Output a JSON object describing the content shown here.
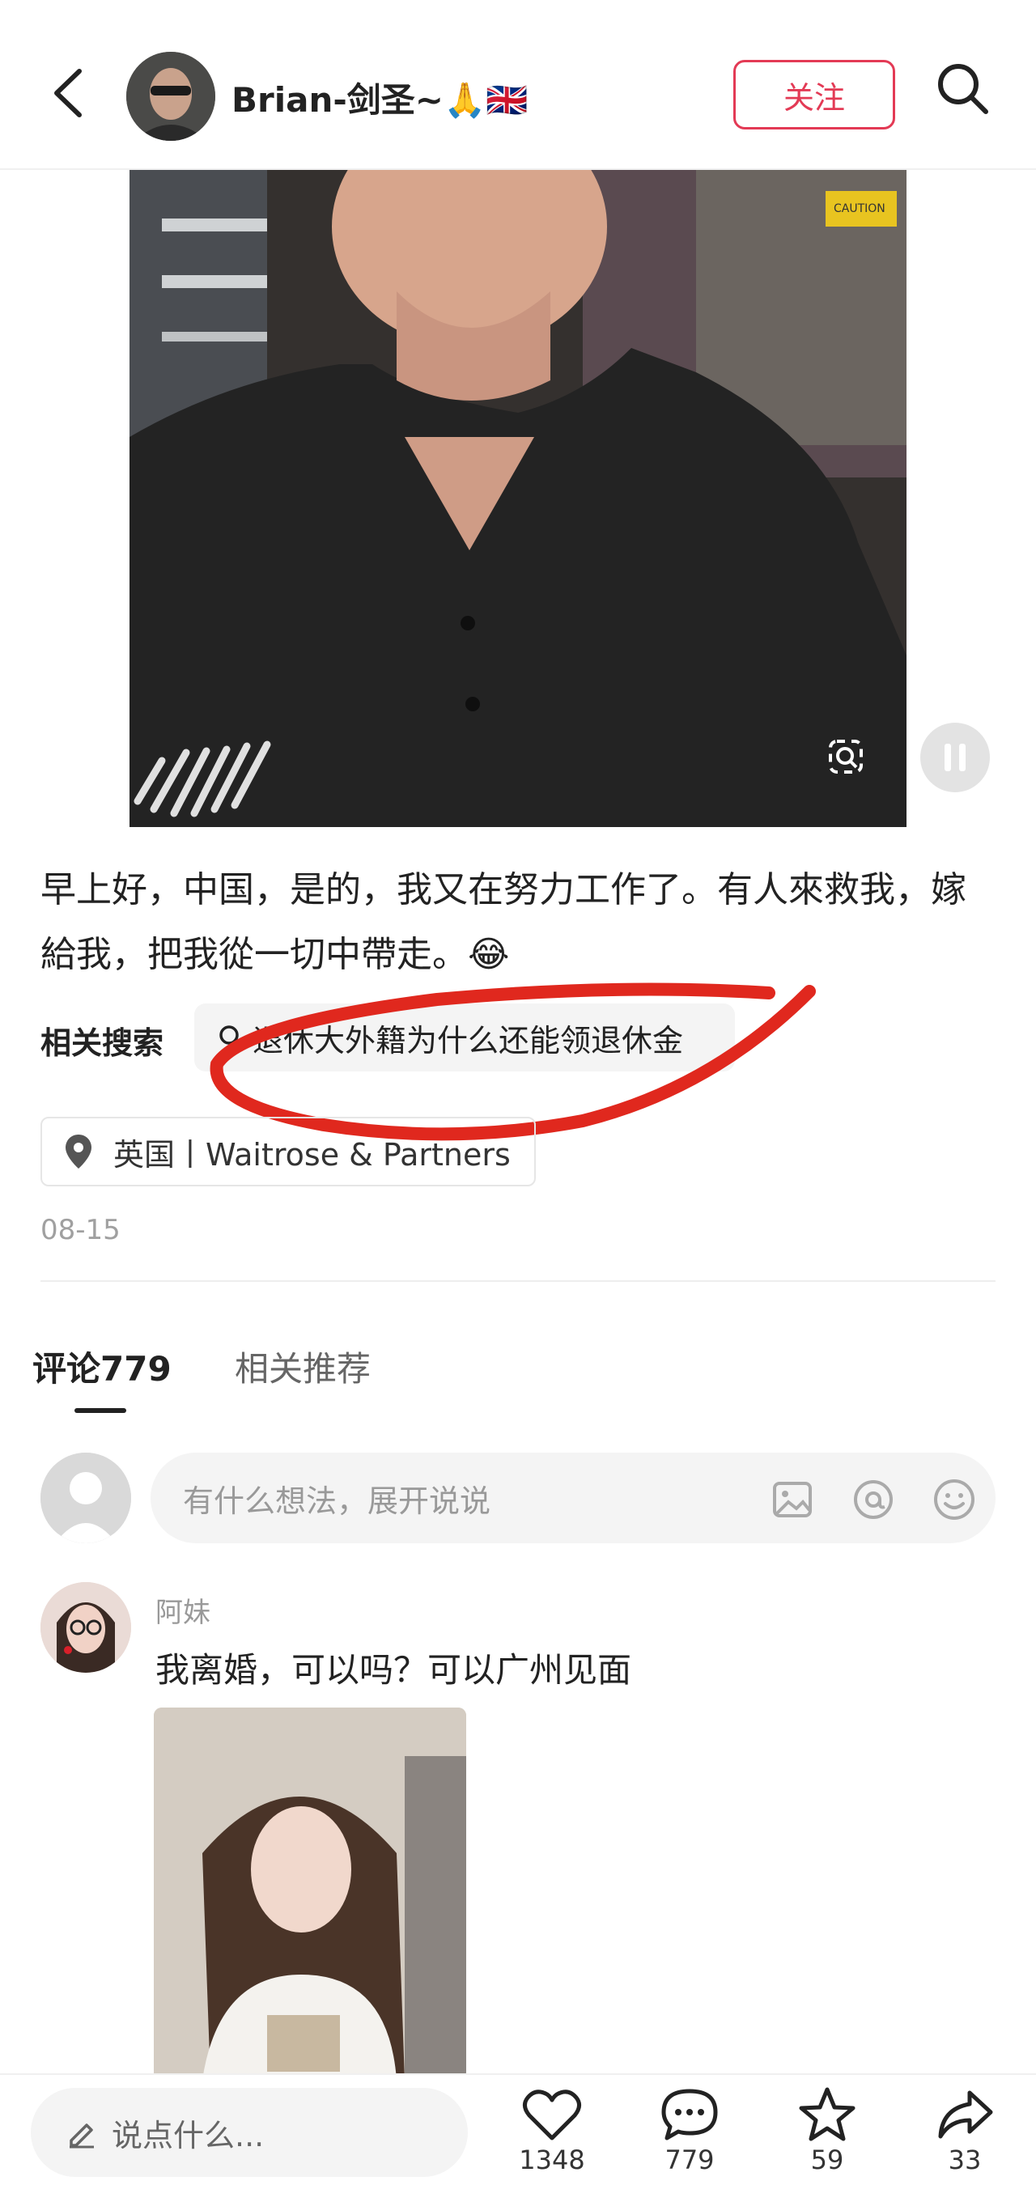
{
  "header": {
    "username": "Brian-剑圣~🙏🇬🇧",
    "follow_label": "关注",
    "icons": [
      "back-arrow-icon",
      "search-icon"
    ]
  },
  "post": {
    "caption": "早上好，中国，是的，我又在努力工作了。有人來救我，嫁給我，把我從一切中帶走。😂",
    "related_search_label": "相关搜索",
    "related_search_query": "退休大外籍为什么还能领退休金",
    "location": "英国丨Waitrose & Partners",
    "date": "08-15",
    "video_sign_text": "CAUTION",
    "annotation_color": "#e0281e"
  },
  "tabs": {
    "comments": "评论779",
    "related": "相关推荐"
  },
  "comment_box": {
    "placeholder": "有什么想法，展开说说"
  },
  "comments": [
    {
      "name": "阿妹",
      "text": "我离婚，可以吗？可以广州见面"
    }
  ],
  "bottom_bar": {
    "say_placeholder": "说点什么...",
    "likes": "1348",
    "comments": "779",
    "favorites": "59",
    "shares": "33"
  },
  "colors": {
    "accent": "#e33a55",
    "text": "#222222",
    "muted": "#999999"
  }
}
